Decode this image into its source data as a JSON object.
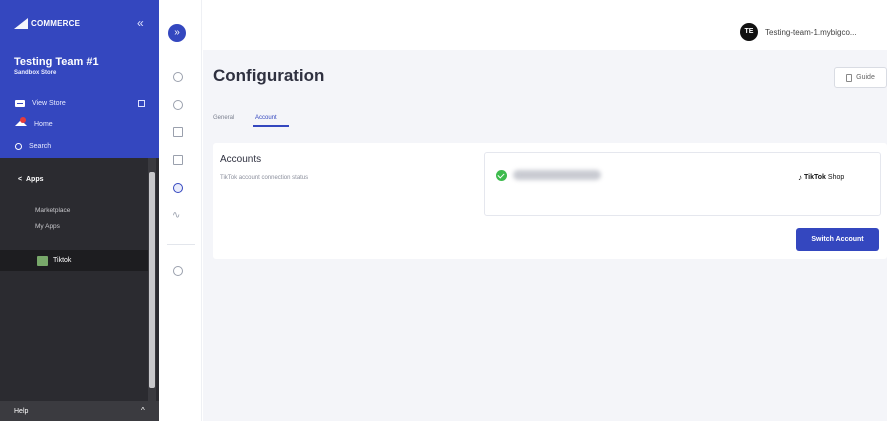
{
  "sidebar": {
    "brand": "COMMERCE",
    "collapse_glyph": "«",
    "team_name": "Testing Team #1",
    "store_type": "Sandbox Store",
    "nav": {
      "view_store": "View Store",
      "home": "Home",
      "search": "Search"
    },
    "apps_label": "Apps",
    "apps_back_glyph": "<",
    "sub_items": [
      "Marketplace",
      "My Apps"
    ],
    "active_app": "Tiktok",
    "help": "Help",
    "help_caret": "^"
  },
  "rail": {
    "toggle_glyph": "»",
    "pulse_glyph": "∿"
  },
  "header": {
    "avatar_initials": "TE",
    "store_url": "Testing-team-1.mybigco..."
  },
  "page": {
    "title": "Configuration",
    "guide_label": "Guide",
    "tabs": [
      {
        "label": "General",
        "active": false
      },
      {
        "label": "Account",
        "active": true
      }
    ]
  },
  "accounts_card": {
    "title": "Accounts",
    "description": "TikTok account connection status",
    "connection_status": "connected",
    "brand_note_glyph": "♪",
    "brand_name": "TikTok",
    "brand_suffix": "Shop",
    "switch_label": "Switch Account"
  },
  "colors": {
    "accent": "#3447bf",
    "sidebar_dark": "#2b2b30",
    "success": "#3dbb4d"
  }
}
